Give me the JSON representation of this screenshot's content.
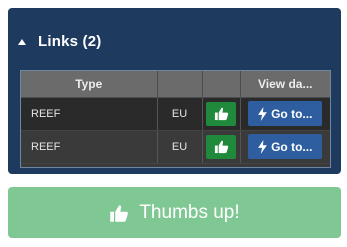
{
  "panel": {
    "title": "Links (2)"
  },
  "table": {
    "headers": [
      "Type",
      "",
      "",
      "View da..."
    ],
    "rows": [
      {
        "type": "REEF",
        "region": "EU",
        "goto_label": "Go to..."
      },
      {
        "type": "REEF",
        "region": "EU",
        "goto_label": "Go to..."
      }
    ]
  },
  "thumbs_button": {
    "label": "Thumbs up!"
  },
  "icons": {
    "collapse": "caret-up-icon",
    "thumb": "thumbs-up-icon",
    "goto": "bolt-icon"
  },
  "colors": {
    "panel_bg": "#1e3a5f",
    "thumb_green": "#1f8a3b",
    "goto_blue": "#2e5ea0",
    "big_button_green": "#80c893"
  }
}
